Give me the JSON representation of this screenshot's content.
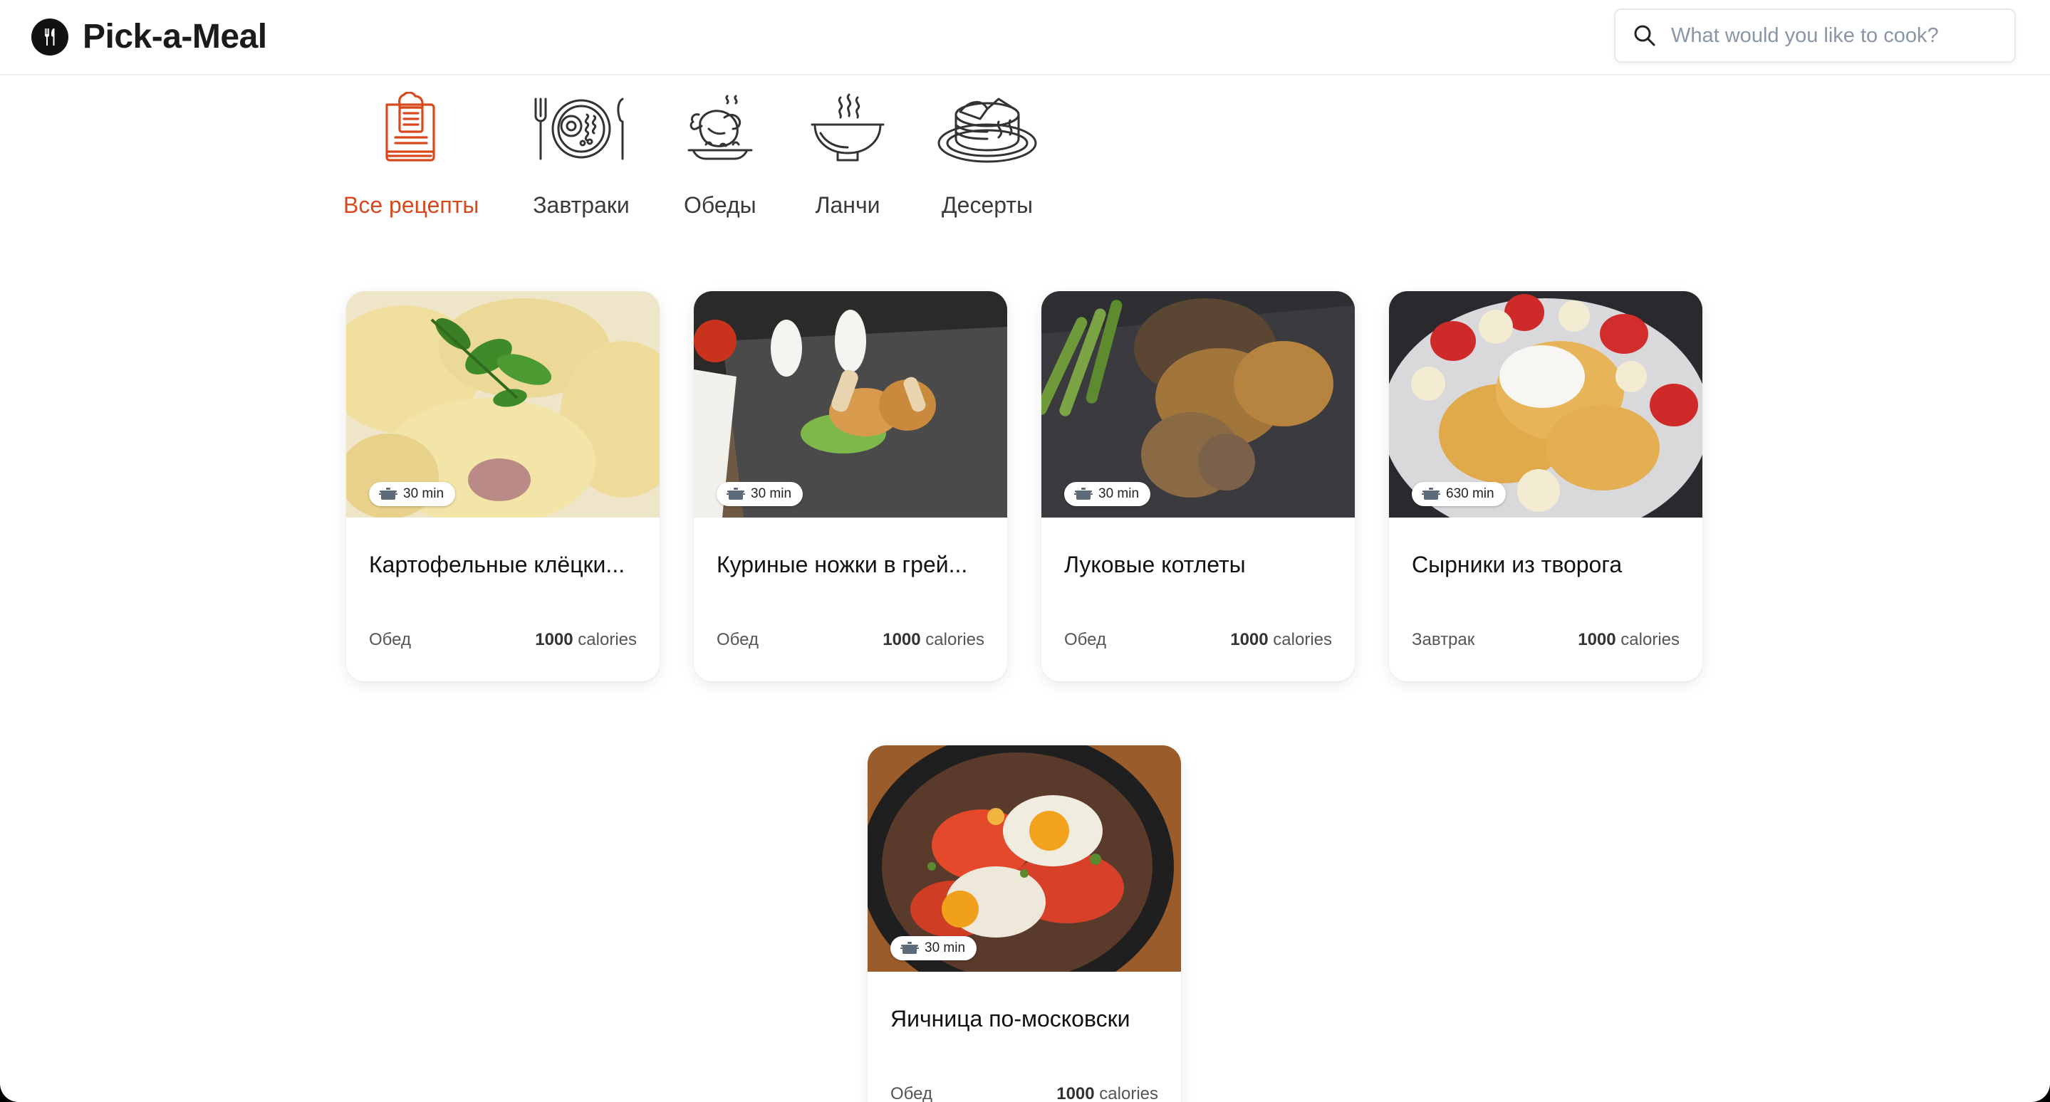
{
  "app": {
    "name": "Pick-a-Meal",
    "logo_icon": "fork-knife-icon"
  },
  "search": {
    "placeholder": "What would you like to cook?",
    "value": ""
  },
  "colors": {
    "accent": "#d9481c",
    "text": "#1b1b1b",
    "muted": "#555555"
  },
  "categories": [
    {
      "label": "Все рецепты",
      "icon": "recipe-book-icon",
      "active": true
    },
    {
      "label": "Завтраки",
      "icon": "breakfast-plate-icon",
      "active": false
    },
    {
      "label": "Обеды",
      "icon": "roast-chicken-icon",
      "active": false
    },
    {
      "label": "Ланчи",
      "icon": "soup-bowl-icon",
      "active": false
    },
    {
      "label": "Десерты",
      "icon": "cake-icon",
      "active": false
    }
  ],
  "recipes": [
    {
      "title": "Картофельные клёцки...",
      "time": "30 min",
      "type": "Обед",
      "calories_value": "1000",
      "calories_unit": "calories"
    },
    {
      "title": "Куриные ножки в грей...",
      "time": "30 min",
      "type": "Обед",
      "calories_value": "1000",
      "calories_unit": "calories"
    },
    {
      "title": "Луковые котлеты",
      "time": "30 min",
      "type": "Обед",
      "calories_value": "1000",
      "calories_unit": "calories"
    },
    {
      "title": "Сырники из творога",
      "time": "630 min",
      "type": "Завтрак",
      "calories_value": "1000",
      "calories_unit": "calories"
    },
    {
      "title": "Яичница по-московски",
      "time": "30 min",
      "type": "Обед",
      "calories_value": "1000",
      "calories_unit": "calories"
    }
  ]
}
